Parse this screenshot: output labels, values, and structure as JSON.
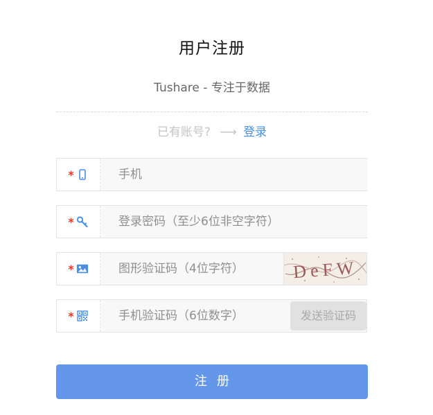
{
  "page": {
    "title": "用户注册",
    "subtitle": "Tushare - 专注于数据"
  },
  "login_prompt": {
    "text": "已有账号?",
    "arrow_icon": "arrow-right-icon",
    "link_label": "登录"
  },
  "fields": {
    "phone": {
      "required": "*",
      "icon": "mobile-phone-icon",
      "placeholder": "手机",
      "value": ""
    },
    "password": {
      "required": "*",
      "icon": "key-icon",
      "placeholder": "登录密码（至少6位非空字符）",
      "value": ""
    },
    "captcha": {
      "required": "*",
      "icon": "image-icon",
      "placeholder": "图形验证码（4位字符）",
      "value": "",
      "captcha_text": "DeFW"
    },
    "sms_code": {
      "required": "*",
      "icon": "qr-code-icon",
      "placeholder": "手机验证码（6位数字）",
      "value": "",
      "send_button_label": "发送验证码"
    }
  },
  "submit": {
    "label": "注册"
  },
  "colors": {
    "accent": "#6496ea",
    "link": "#4a8fe2",
    "required": "#e8392b",
    "icon": "#4a8fe2"
  }
}
